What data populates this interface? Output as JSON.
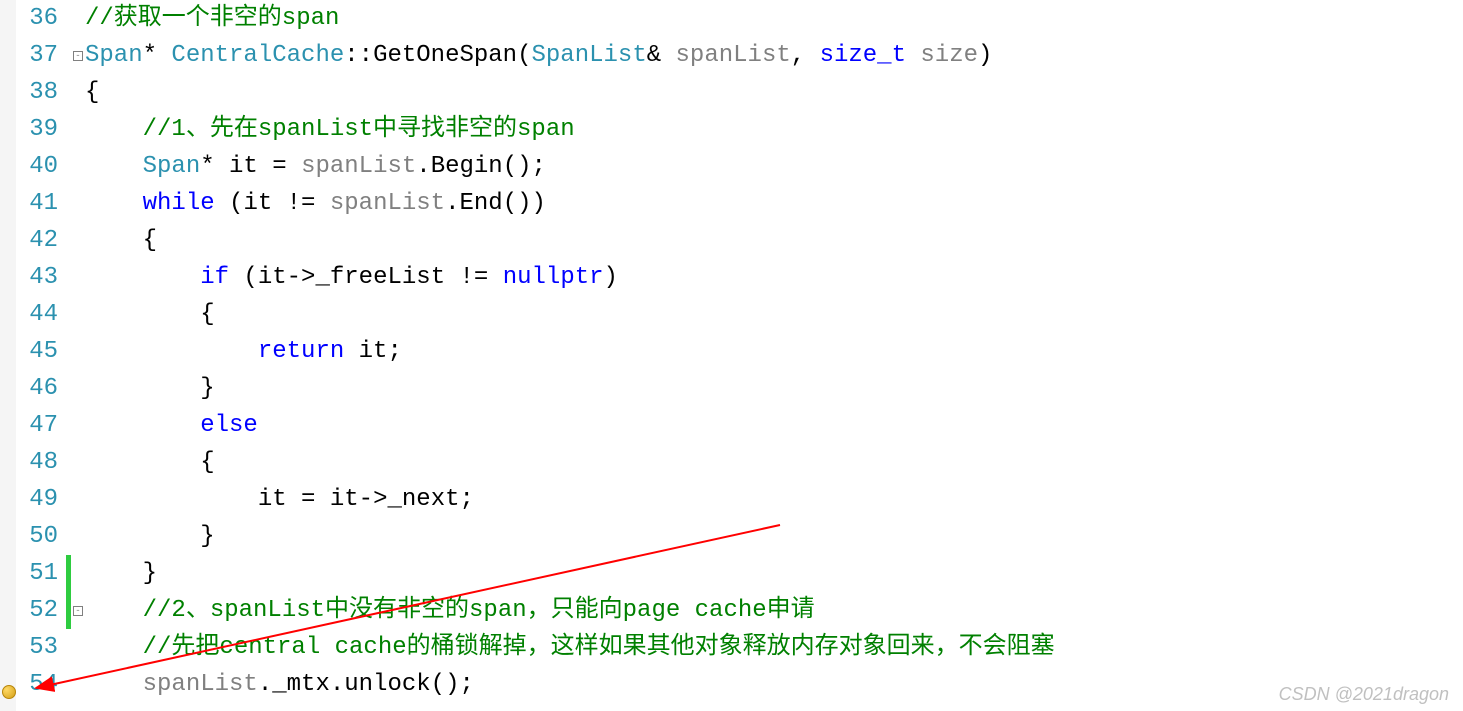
{
  "watermark": "CSDN @2021dragon",
  "lines": [
    {
      "num": "36",
      "fold": "",
      "change": "",
      "tokens": [
        {
          "cls": "comment",
          "t": "//获取一个非空的span"
        }
      ]
    },
    {
      "num": "37",
      "fold": "-",
      "change": "",
      "tokens": [
        {
          "cls": "type",
          "t": "Span"
        },
        {
          "cls": "punct",
          "t": "* "
        },
        {
          "cls": "type",
          "t": "CentralCache"
        },
        {
          "cls": "punct",
          "t": "::"
        },
        {
          "cls": "identifier",
          "t": "GetOneSpan"
        },
        {
          "cls": "punct",
          "t": "("
        },
        {
          "cls": "type",
          "t": "SpanList"
        },
        {
          "cls": "punct",
          "t": "& "
        },
        {
          "cls": "param",
          "t": "spanList"
        },
        {
          "cls": "punct",
          "t": ", "
        },
        {
          "cls": "keyword",
          "t": "size_t"
        },
        {
          "cls": "punct",
          "t": " "
        },
        {
          "cls": "param",
          "t": "size"
        },
        {
          "cls": "punct",
          "t": ")"
        }
      ]
    },
    {
      "num": "38",
      "fold": "",
      "change": "",
      "tokens": [
        {
          "cls": "punct",
          "t": "{"
        }
      ]
    },
    {
      "num": "39",
      "fold": "",
      "change": "",
      "tokens": [
        {
          "cls": "punct",
          "t": "    "
        },
        {
          "cls": "comment",
          "t": "//1、先在spanList中寻找非空的span"
        }
      ]
    },
    {
      "num": "40",
      "fold": "",
      "change": "",
      "tokens": [
        {
          "cls": "punct",
          "t": "    "
        },
        {
          "cls": "type",
          "t": "Span"
        },
        {
          "cls": "punct",
          "t": "* "
        },
        {
          "cls": "identifier",
          "t": "it"
        },
        {
          "cls": "punct",
          "t": " = "
        },
        {
          "cls": "param",
          "t": "spanList"
        },
        {
          "cls": "punct",
          "t": "."
        },
        {
          "cls": "identifier",
          "t": "Begin"
        },
        {
          "cls": "punct",
          "t": "();"
        }
      ]
    },
    {
      "num": "41",
      "fold": "",
      "change": "",
      "tokens": [
        {
          "cls": "punct",
          "t": "    "
        },
        {
          "cls": "keyword",
          "t": "while"
        },
        {
          "cls": "punct",
          "t": " ("
        },
        {
          "cls": "identifier",
          "t": "it"
        },
        {
          "cls": "punct",
          "t": " != "
        },
        {
          "cls": "param",
          "t": "spanList"
        },
        {
          "cls": "punct",
          "t": "."
        },
        {
          "cls": "identifier",
          "t": "End"
        },
        {
          "cls": "punct",
          "t": "())"
        }
      ]
    },
    {
      "num": "42",
      "fold": "",
      "change": "",
      "tokens": [
        {
          "cls": "punct",
          "t": "    {"
        }
      ]
    },
    {
      "num": "43",
      "fold": "",
      "change": "",
      "tokens": [
        {
          "cls": "punct",
          "t": "        "
        },
        {
          "cls": "keyword",
          "t": "if"
        },
        {
          "cls": "punct",
          "t": " ("
        },
        {
          "cls": "identifier",
          "t": "it"
        },
        {
          "cls": "punct",
          "t": "->"
        },
        {
          "cls": "identifier",
          "t": "_freeList"
        },
        {
          "cls": "punct",
          "t": " != "
        },
        {
          "cls": "literal",
          "t": "nullptr"
        },
        {
          "cls": "punct",
          "t": ")"
        }
      ]
    },
    {
      "num": "44",
      "fold": "",
      "change": "",
      "tokens": [
        {
          "cls": "punct",
          "t": "        {"
        }
      ]
    },
    {
      "num": "45",
      "fold": "",
      "change": "",
      "tokens": [
        {
          "cls": "punct",
          "t": "            "
        },
        {
          "cls": "keyword",
          "t": "return"
        },
        {
          "cls": "punct",
          "t": " "
        },
        {
          "cls": "identifier",
          "t": "it"
        },
        {
          "cls": "punct",
          "t": ";"
        }
      ]
    },
    {
      "num": "46",
      "fold": "",
      "change": "",
      "tokens": [
        {
          "cls": "punct",
          "t": "        }"
        }
      ]
    },
    {
      "num": "47",
      "fold": "",
      "change": "",
      "tokens": [
        {
          "cls": "punct",
          "t": "        "
        },
        {
          "cls": "keyword",
          "t": "else"
        }
      ]
    },
    {
      "num": "48",
      "fold": "",
      "change": "",
      "tokens": [
        {
          "cls": "punct",
          "t": "        {"
        }
      ]
    },
    {
      "num": "49",
      "fold": "",
      "change": "",
      "tokens": [
        {
          "cls": "punct",
          "t": "            "
        },
        {
          "cls": "identifier",
          "t": "it"
        },
        {
          "cls": "punct",
          "t": " = "
        },
        {
          "cls": "identifier",
          "t": "it"
        },
        {
          "cls": "punct",
          "t": "->"
        },
        {
          "cls": "identifier",
          "t": "_next"
        },
        {
          "cls": "punct",
          "t": ";"
        }
      ]
    },
    {
      "num": "50",
      "fold": "",
      "change": "",
      "tokens": [
        {
          "cls": "punct",
          "t": "        }"
        }
      ]
    },
    {
      "num": "51",
      "fold": "",
      "change": "green",
      "tokens": [
        {
          "cls": "punct",
          "t": "    }"
        }
      ]
    },
    {
      "num": "52",
      "fold": "-",
      "change": "green",
      "tokens": [
        {
          "cls": "punct",
          "t": "    "
        },
        {
          "cls": "comment",
          "t": "//2、spanList中没有非空的span，只能向page cache申请"
        }
      ]
    },
    {
      "num": "53",
      "fold": "",
      "change": "",
      "tokens": [
        {
          "cls": "punct",
          "t": "    "
        },
        {
          "cls": "comment",
          "t": "//先把central cache的桶锁解掉，这样如果其他对象释放内存对象回来，不会阻塞"
        }
      ]
    },
    {
      "num": "54",
      "fold": "",
      "change": "",
      "tokens": [
        {
          "cls": "punct",
          "t": "    "
        },
        {
          "cls": "param",
          "t": "spanList"
        },
        {
          "cls": "punct",
          "t": "."
        },
        {
          "cls": "identifier",
          "t": "_mtx"
        },
        {
          "cls": "punct",
          "t": "."
        },
        {
          "cls": "identifier",
          "t": "unlock"
        },
        {
          "cls": "punct",
          "t": "();"
        }
      ]
    }
  ]
}
